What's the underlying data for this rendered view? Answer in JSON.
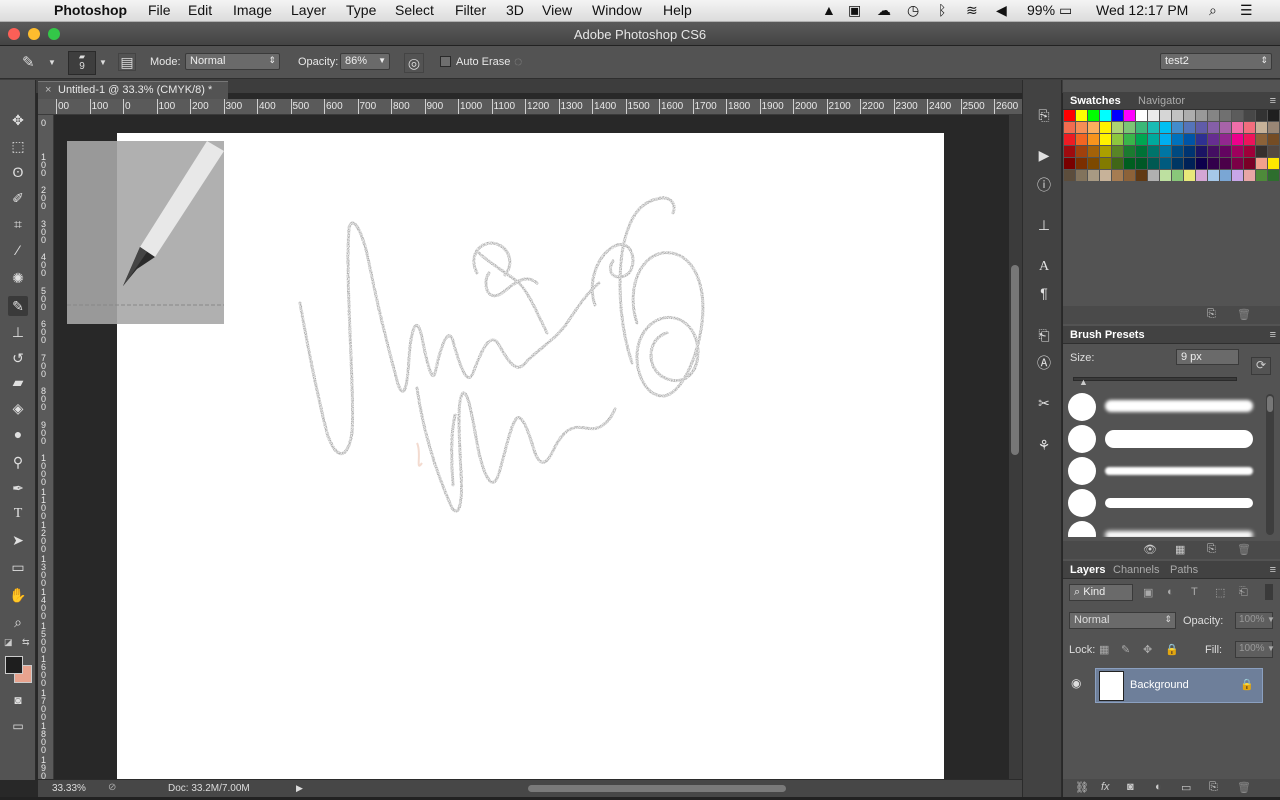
{
  "menubar": {
    "apple": "",
    "app": "Photoshop",
    "items": [
      "File",
      "Edit",
      "Image",
      "Layer",
      "Type",
      "Select",
      "Filter",
      "3D",
      "View",
      "Window",
      "Help"
    ],
    "battery": "99%",
    "clock": "Wed 12:17 PM"
  },
  "window": {
    "title": "Adobe Photoshop CS6"
  },
  "options": {
    "brush_size": "9",
    "mode_label": "Mode:",
    "mode_value": "Normal",
    "opacity_label": "Opacity:",
    "opacity_value": "86%",
    "auto_erase": "Auto Erase",
    "workspace": "test2"
  },
  "document": {
    "tab_title": "Untitled-1 @ 33.3% (CMYK/8) *",
    "zoom": "33.33%",
    "doc_size": "Doc: 33.2M/7.00M"
  },
  "ruler": {
    "h_ticks": [
      "00",
      "100",
      "0",
      "100",
      "200",
      "300",
      "400",
      "500",
      "600",
      "700",
      "800",
      "900",
      "1000",
      "1100",
      "1200",
      "1300",
      "1400",
      "1500",
      "1600",
      "1700",
      "1800",
      "1900",
      "2000",
      "2100",
      "2200",
      "2300",
      "2400",
      "2500",
      "2600"
    ],
    "v_ticks": [
      "0",
      "100",
      "200",
      "300",
      "400",
      "500",
      "600",
      "700",
      "800",
      "900",
      "1000",
      "1100",
      "1200",
      "1300",
      "1400",
      "1500",
      "1600",
      "1700",
      "1800",
      "1900",
      "2000"
    ]
  },
  "swatches_panel": {
    "tabs": [
      "Swatches",
      "Navigator"
    ],
    "colors": [
      "#ff0000",
      "#ffff00",
      "#00ff00",
      "#00ffff",
      "#0000ff",
      "#ff00ff",
      "#ffffff",
      "#ebebeb",
      "#d6d6d6",
      "#c2c2c2",
      "#adadad",
      "#999999",
      "#858585",
      "#707070",
      "#5c5c5c",
      "#474747",
      "#333333",
      "#1f1f1f",
      "#000000",
      "#ee1d24",
      "#f7941d",
      "#fdbb63",
      "#f26c4f",
      "#f68e55",
      "#fbaf5d",
      "#fff200",
      "#acd372",
      "#7cc576",
      "#3bb878",
      "#1abbb4",
      "#00bff3",
      "#438ccb",
      "#5574b9",
      "#605ca8",
      "#855fa8",
      "#a763a9",
      "#f06ea9",
      "#f26d7d",
      "#c7b299",
      "#998675",
      "#736357",
      "#534741",
      "#c69c6d",
      "#a67c52",
      "#ed1c24",
      "#f26522",
      "#f7941d",
      "#fff200",
      "#8dc63f",
      "#39b54a",
      "#00a651",
      "#00a99d",
      "#00aeef",
      "#0072bc",
      "#0054a6",
      "#2e3192",
      "#662d91",
      "#92278f",
      "#ec008c",
      "#ed145b",
      "#8c6239",
      "#754c24",
      "#603913",
      "#42210b",
      "#fbaf5d",
      "#f68e56",
      "#9e0b0f",
      "#a0410d",
      "#a36209",
      "#aba000",
      "#598527",
      "#1a7b30",
      "#007236",
      "#00746b",
      "#0076a3",
      "#004a80",
      "#003471",
      "#1b1464",
      "#440e62",
      "#630460",
      "#9e005d",
      "#9e0039",
      "#362f2d",
      "#534741",
      "#998675",
      "#c7b299",
      "#e6ccb2",
      "#c69c6d",
      "#790000",
      "#7b2e00",
      "#7d4900",
      "#827b00",
      "#406618",
      "#005e20",
      "#005826",
      "#005952",
      "#005b7f",
      "#003663",
      "#002157",
      "#0d004c",
      "#32004b",
      "#4b0049",
      "#7b0046",
      "#7a0026",
      "#f2a08c",
      "#ffe600",
      "#ffffff",
      "#8dc63f",
      "#f04e45",
      "#ff8080",
      "#5c4d3c",
      "#82735c",
      "#a89a83",
      "#c7b299",
      "#a67c52",
      "#8c6239",
      "#603913",
      "#b0b0b0",
      "#bde0a0",
      "#89c77a",
      "#e8e87a",
      "#d4a6d4",
      "#a6c8e8",
      "#7aa6d4",
      "#c8a6e8",
      "#e8a6a6",
      "#4e8a3a",
      "#2e6e2e",
      "#6e2e2e",
      "#ff6666",
      "#ee82ee",
      "#333366"
    ]
  },
  "brush_presets": {
    "title": "Brush Presets",
    "size_label": "Size:",
    "size_value": "9 px"
  },
  "layers_panel": {
    "tabs": [
      "Layers",
      "Channels",
      "Paths"
    ],
    "kind_label": "Kind",
    "blend_mode": "Normal",
    "opacity_label": "Opacity:",
    "opacity_value": "100%",
    "lock_label": "Lock:",
    "fill_label": "Fill:",
    "fill_value": "100%",
    "layer_name": "Background"
  },
  "colors": {
    "foreground": "#1e1e1e",
    "background": "#e8a38e",
    "panel": "#535353",
    "selected_layer": "#6e7f9a"
  }
}
